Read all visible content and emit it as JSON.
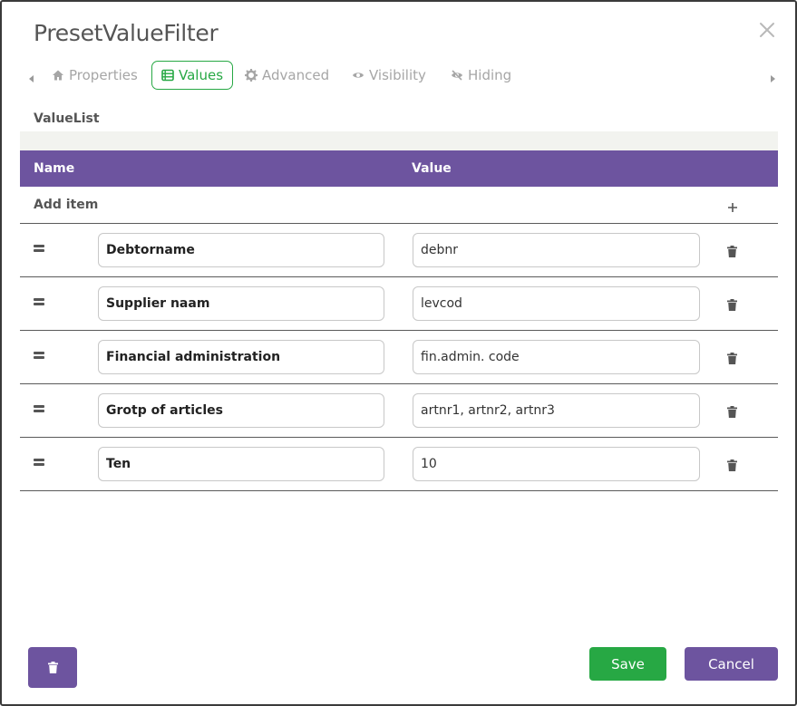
{
  "dialog": {
    "title": "PresetValueFilter",
    "close_icon": "close-icon"
  },
  "tabs": [
    {
      "label": "Properties",
      "icon": "home-icon",
      "active": false
    },
    {
      "label": "Values",
      "icon": "list-icon",
      "active": true
    },
    {
      "label": "Advanced",
      "icon": "gear-icon",
      "active": false
    },
    {
      "label": "Visibility",
      "icon": "eye-icon",
      "active": false
    },
    {
      "label": "Hiding",
      "icon": "eye-slash-icon",
      "active": false
    }
  ],
  "section": {
    "label": "ValueList"
  },
  "table": {
    "headers": {
      "name": "Name",
      "value": "Value"
    },
    "add_item_label": "Add item",
    "rows": [
      {
        "name": "Debtorname",
        "value": "debnr"
      },
      {
        "name": "Supplier naam",
        "value": "levcod"
      },
      {
        "name": "Financial administration",
        "value": "fin.admin. code"
      },
      {
        "name": "Grotp of articles",
        "value": "artnr1, artnr2, artnr3"
      },
      {
        "name": "Ten",
        "value": "10"
      }
    ]
  },
  "footer": {
    "save_label": "Save",
    "cancel_label": "Cancel"
  },
  "colors": {
    "accent_purple": "#6d549f",
    "accent_green": "#27a844",
    "tab_inactive": "#a6a6a6"
  }
}
